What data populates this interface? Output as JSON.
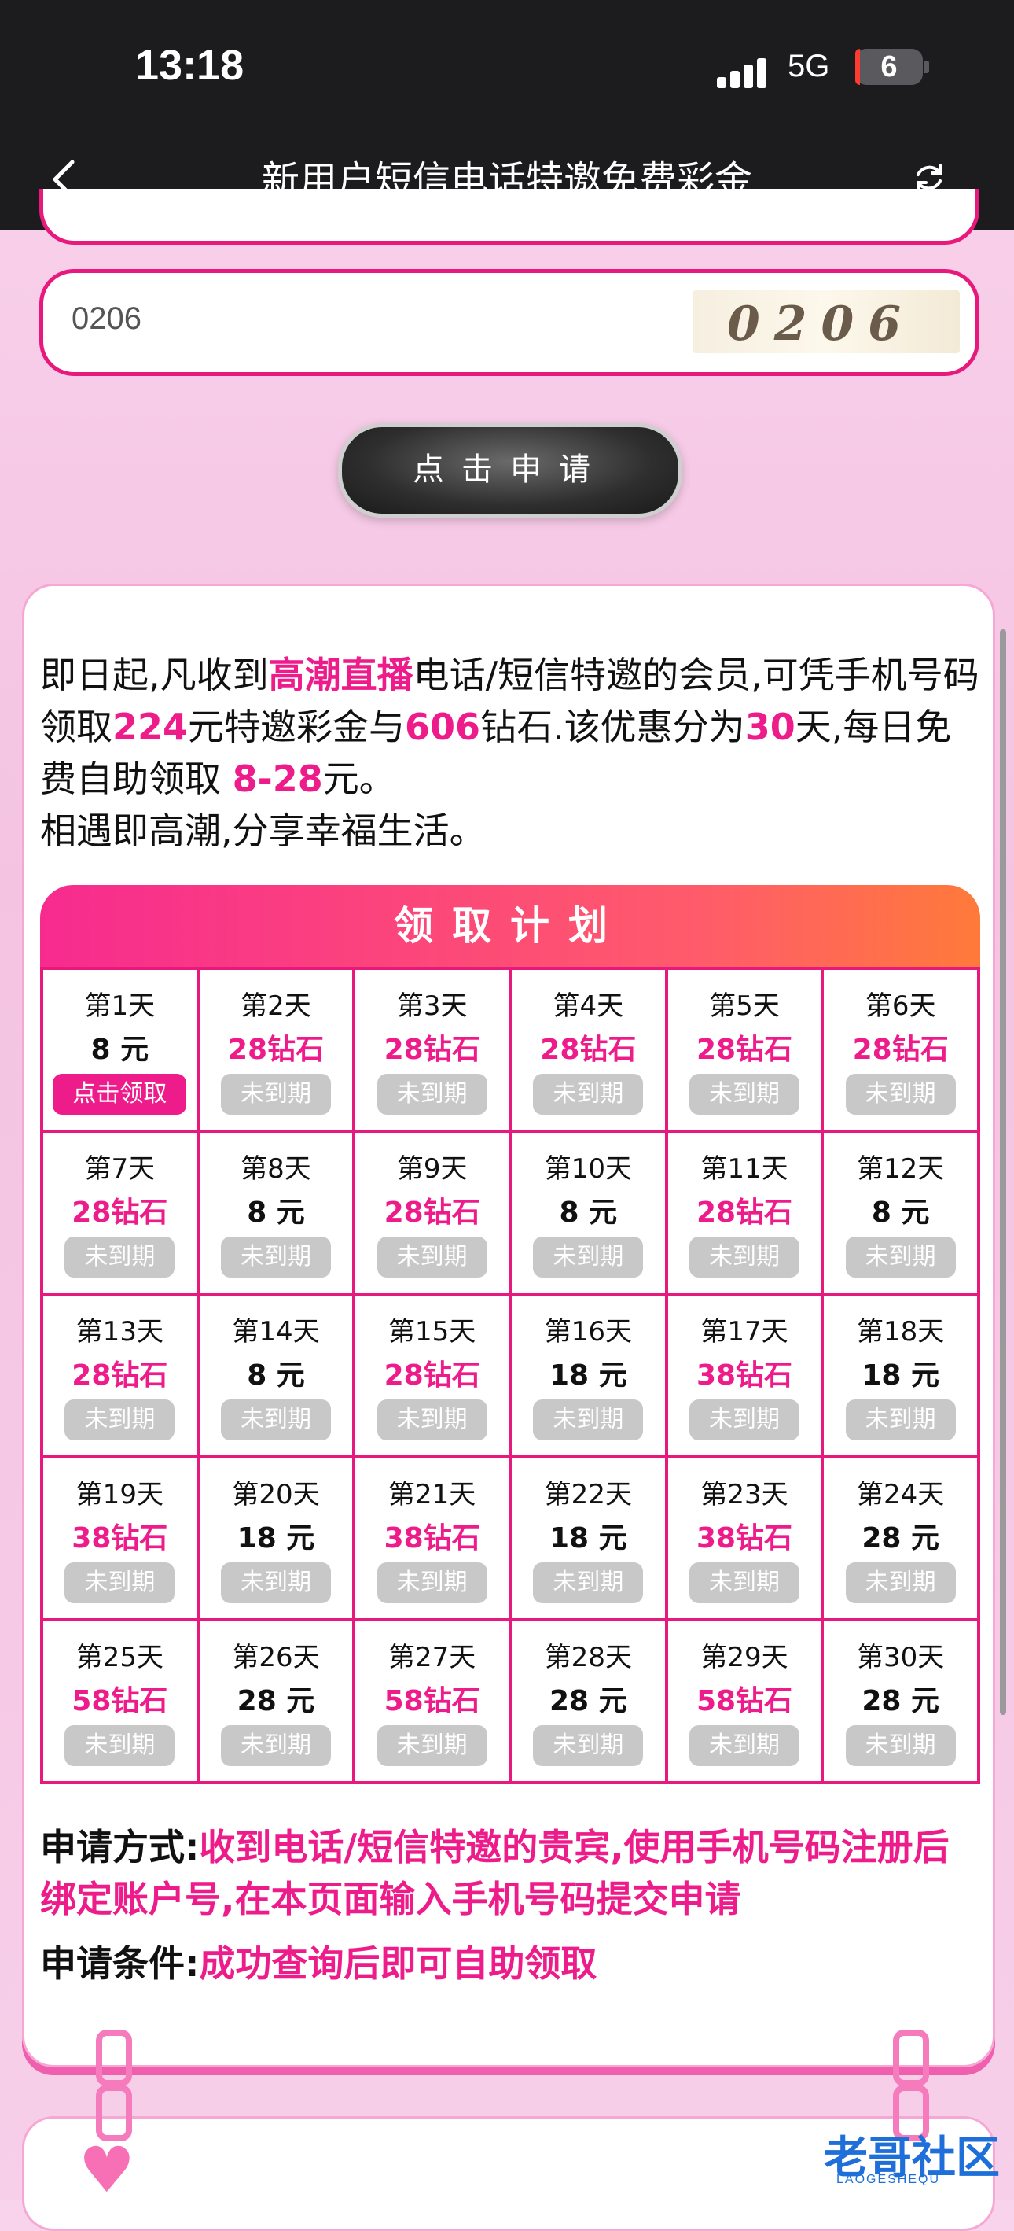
{
  "status_bar": {
    "time": "13:18",
    "network": "5G",
    "battery": "6"
  },
  "nav": {
    "title": "新用户短信电话特邀免费彩金"
  },
  "form": {
    "captcha_value": "0206",
    "captcha_image_text": "0206",
    "apply_button": "点击申请"
  },
  "intro": {
    "p1": "即日起,凡收到",
    "brand": "高潮直播",
    "p2": "电话/短信特邀的会员,可凭手机号码领取",
    "amount": "224",
    "p3": "元特邀彩金与",
    "diamonds": "606",
    "p4": "钻石.该优惠分为",
    "days": "30",
    "p5": "天,每日免费自助领取 ",
    "range": "8-28",
    "p6": "元。",
    "line2": "相遇即高潮,分享幸福生活。"
  },
  "plan": {
    "title": "领取计划",
    "days": [
      {
        "day": "第1天",
        "reward": "8 元",
        "diamond": false,
        "status": "点击领取",
        "active": true
      },
      {
        "day": "第2天",
        "reward": "28钻石",
        "diamond": true,
        "status": "未到期",
        "active": false
      },
      {
        "day": "第3天",
        "reward": "28钻石",
        "diamond": true,
        "status": "未到期",
        "active": false
      },
      {
        "day": "第4天",
        "reward": "28钻石",
        "diamond": true,
        "status": "未到期",
        "active": false
      },
      {
        "day": "第5天",
        "reward": "28钻石",
        "diamond": true,
        "status": "未到期",
        "active": false
      },
      {
        "day": "第6天",
        "reward": "28钻石",
        "diamond": true,
        "status": "未到期",
        "active": false
      },
      {
        "day": "第7天",
        "reward": "28钻石",
        "diamond": true,
        "status": "未到期",
        "active": false
      },
      {
        "day": "第8天",
        "reward": "8 元",
        "diamond": false,
        "status": "未到期",
        "active": false
      },
      {
        "day": "第9天",
        "reward": "28钻石",
        "diamond": true,
        "status": "未到期",
        "active": false
      },
      {
        "day": "第10天",
        "reward": "8 元",
        "diamond": false,
        "status": "未到期",
        "active": false
      },
      {
        "day": "第11天",
        "reward": "28钻石",
        "diamond": true,
        "status": "未到期",
        "active": false
      },
      {
        "day": "第12天",
        "reward": "8 元",
        "diamond": false,
        "status": "未到期",
        "active": false
      },
      {
        "day": "第13天",
        "reward": "28钻石",
        "diamond": true,
        "status": "未到期",
        "active": false
      },
      {
        "day": "第14天",
        "reward": "8 元",
        "diamond": false,
        "status": "未到期",
        "active": false
      },
      {
        "day": "第15天",
        "reward": "28钻石",
        "diamond": true,
        "status": "未到期",
        "active": false
      },
      {
        "day": "第16天",
        "reward": "18 元",
        "diamond": false,
        "status": "未到期",
        "active": false
      },
      {
        "day": "第17天",
        "reward": "38钻石",
        "diamond": true,
        "status": "未到期",
        "active": false
      },
      {
        "day": "第18天",
        "reward": "18 元",
        "diamond": false,
        "status": "未到期",
        "active": false
      },
      {
        "day": "第19天",
        "reward": "38钻石",
        "diamond": true,
        "status": "未到期",
        "active": false
      },
      {
        "day": "第20天",
        "reward": "18 元",
        "diamond": false,
        "status": "未到期",
        "active": false
      },
      {
        "day": "第21天",
        "reward": "38钻石",
        "diamond": true,
        "status": "未到期",
        "active": false
      },
      {
        "day": "第22天",
        "reward": "18 元",
        "diamond": false,
        "status": "未到期",
        "active": false
      },
      {
        "day": "第23天",
        "reward": "38钻石",
        "diamond": true,
        "status": "未到期",
        "active": false
      },
      {
        "day": "第24天",
        "reward": "28 元",
        "diamond": false,
        "status": "未到期",
        "active": false
      },
      {
        "day": "第25天",
        "reward": "58钻石",
        "diamond": true,
        "status": "未到期",
        "active": false
      },
      {
        "day": "第26天",
        "reward": "28 元",
        "diamond": false,
        "status": "未到期",
        "active": false
      },
      {
        "day": "第27天",
        "reward": "58钻石",
        "diamond": true,
        "status": "未到期",
        "active": false
      },
      {
        "day": "第28天",
        "reward": "28 元",
        "diamond": false,
        "status": "未到期",
        "active": false
      },
      {
        "day": "第29天",
        "reward": "58钻石",
        "diamond": true,
        "status": "未到期",
        "active": false
      },
      {
        "day": "第30天",
        "reward": "28 元",
        "diamond": false,
        "status": "未到期",
        "active": false
      }
    ]
  },
  "method": {
    "label": "申请方式:",
    "text": "收到电话/短信特邀的贵宾,使用手机号码注册后绑定账户号,在本页面输入手机号码提交申请"
  },
  "condition": {
    "label": "申请条件:",
    "text": "成功查询后即可自助领取"
  },
  "watermark": {
    "text": "老哥社区",
    "sub": "LAOGESHEQU"
  },
  "colors": {
    "accent": "#ee1c8a",
    "header_gradient_end": "#ff7a3a",
    "pending_gray": "#c8c8c8"
  },
  "icons": {
    "back": "chevron-left-icon",
    "refresh": "refresh-icon",
    "heart": "heart-icon"
  }
}
